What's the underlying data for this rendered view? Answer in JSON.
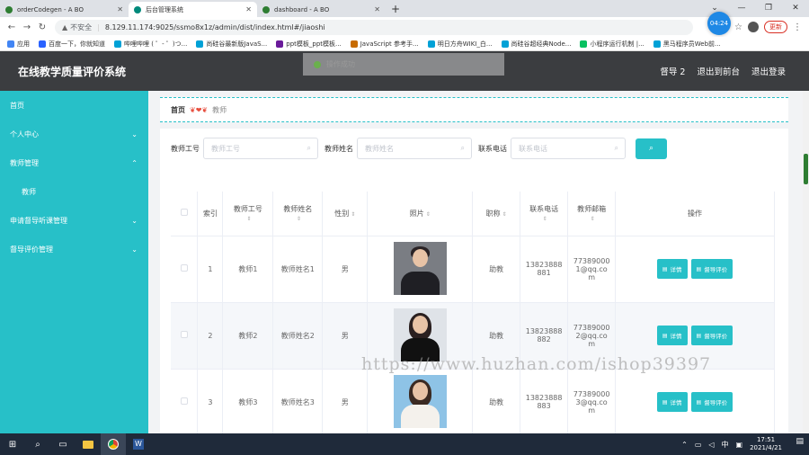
{
  "browser": {
    "tabs": [
      {
        "title": "orderCodegen - A BO",
        "color": "#2e7d32",
        "active": false
      },
      {
        "title": "后台管理系统",
        "color": "#00897b",
        "active": true
      },
      {
        "title": "dashboard - A BO",
        "color": "#2e7d32",
        "active": false
      }
    ],
    "new_tab": "+",
    "url_warning": "不安全",
    "url": "8.129.11.174:9025/ssmo8x1z/admin/dist/index.html#/jiaoshi",
    "time_bubble": "04:24",
    "update_label": "更新",
    "bookmarks": [
      {
        "label": "应用",
        "color": "#4285f4"
      },
      {
        "label": "百度一下，你就知道",
        "color": "#2962ff"
      },
      {
        "label": "哔哩哔哩 ( ゜- ゜)つ...",
        "color": "#00a1d6"
      },
      {
        "label": "尚硅谷最新版JavaS...",
        "color": "#00a1d6"
      },
      {
        "label": "ppt模板_ppt模板...",
        "color": "#6a1b9a"
      },
      {
        "label": "JavaScript 参考手...",
        "color": "#c76b00"
      },
      {
        "label": "明日方舟WIKI_白...",
        "color": "#00a1d6"
      },
      {
        "label": "尚硅谷超经典Node...",
        "color": "#00a1d6"
      },
      {
        "label": "小程序运行机制 |...",
        "color": "#07c160"
      },
      {
        "label": "黑马程序员Web前...",
        "color": "#00a1d6"
      }
    ]
  },
  "header": {
    "title": "在线教学质量评价系统",
    "right_links": [
      "督导 2",
      "退出到前台",
      "退出登录"
    ]
  },
  "toast": {
    "text": "操作成功"
  },
  "sidebar": {
    "items": [
      {
        "label": "首页",
        "chevron": ""
      },
      {
        "label": "个人中心",
        "chevron": "⌄"
      },
      {
        "label": "教师管理",
        "chevron": "⌃"
      },
      {
        "label": "教师",
        "sub": true
      },
      {
        "label": "申请督导听课管理",
        "chevron": "⌄"
      },
      {
        "label": "督导评价管理",
        "chevron": "⌄"
      }
    ]
  },
  "breadcrumb": {
    "home": "首页",
    "separator": "❦❤❦",
    "current": "教师"
  },
  "search": {
    "fields": [
      {
        "label": "教师工号",
        "placeholder": "教师工号"
      },
      {
        "label": "教师姓名",
        "placeholder": "教师姓名"
      },
      {
        "label": "联系电话",
        "placeholder": "联系电话"
      }
    ]
  },
  "table": {
    "headers": [
      "索引",
      "教师工号",
      "教师姓名",
      "性别",
      "照片",
      "职称",
      "联系电话",
      "教师邮箱",
      "操作"
    ],
    "rows": [
      {
        "index": "1",
        "id": "教师1",
        "name": "教师姓名1",
        "gender": "男",
        "title": "助教",
        "phone": [
          "13823888",
          "881"
        ],
        "email": [
          "77389000",
          "1@qq.co",
          "m"
        ]
      },
      {
        "index": "2",
        "id": "教师2",
        "name": "教师姓名2",
        "gender": "男",
        "title": "助教",
        "phone": [
          "13823888",
          "882"
        ],
        "email": [
          "77389000",
          "2@qq.co",
          "m"
        ]
      },
      {
        "index": "3",
        "id": "教师3",
        "name": "教师姓名3",
        "gender": "男",
        "title": "助教",
        "phone": [
          "13823888",
          "883"
        ],
        "email": [
          "77389000",
          "3@qq.co",
          "m"
        ]
      }
    ],
    "actions": {
      "detail": "详情",
      "evaluate": "督导评价"
    }
  },
  "watermark": "https://www.huzhan.com/ishop39397",
  "taskbar": {
    "lang": "中",
    "time": "17:51",
    "date": "2021/4/21"
  }
}
